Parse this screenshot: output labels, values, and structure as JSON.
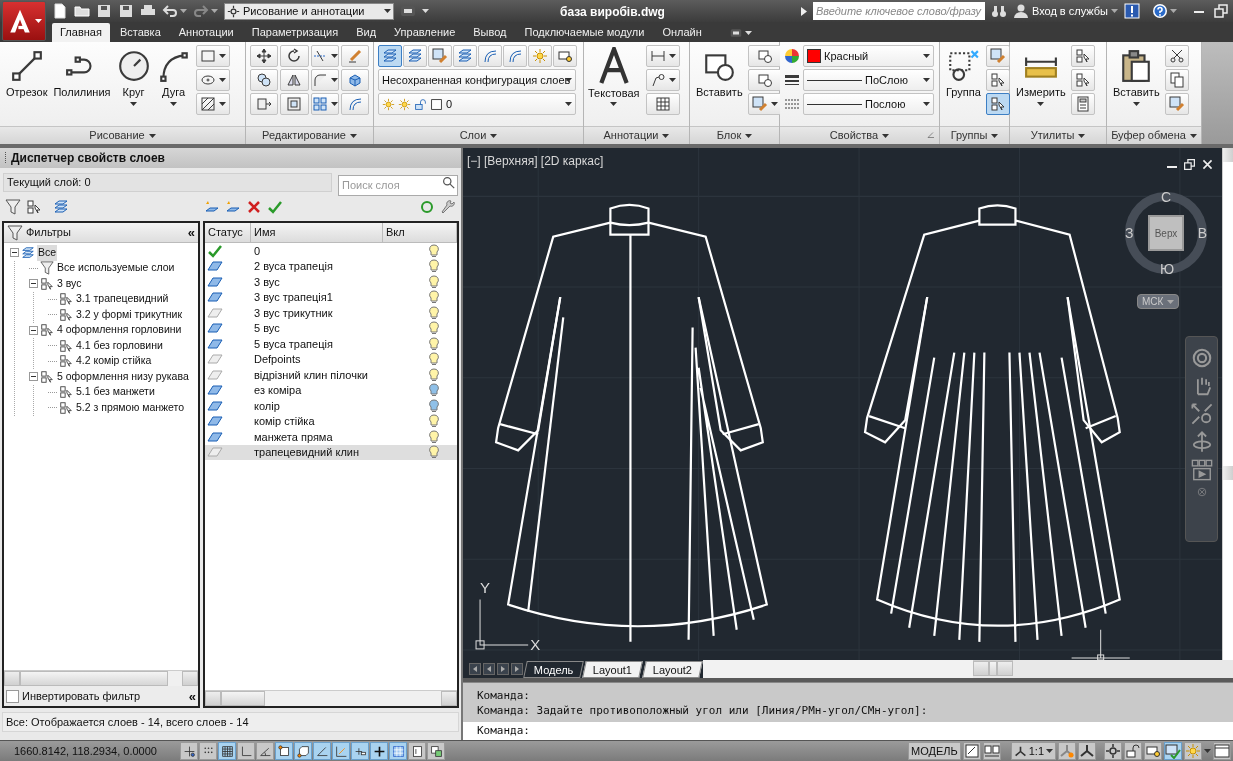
{
  "title_bar": {
    "workspace": "Рисование и аннотации",
    "title": "база виробів.dwg",
    "search_placeholder": "Введите ключевое слово/фразу",
    "sign_in": "Вход в службы"
  },
  "ribbon_tabs": [
    {
      "label": "Главная",
      "selected": true
    },
    {
      "label": "Вставка",
      "selected": false
    },
    {
      "label": "Аннотации",
      "selected": false
    },
    {
      "label": "Параметризация",
      "selected": false
    },
    {
      "label": "Вид",
      "selected": false
    },
    {
      "label": "Управление",
      "selected": false
    },
    {
      "label": "Вывод",
      "selected": false
    },
    {
      "label": "Подключаемые модули",
      "selected": false
    },
    {
      "label": "Онлайн",
      "selected": false
    }
  ],
  "ribbon": {
    "draw": {
      "label": "Рисование",
      "buttons": [
        "Отрезок",
        "Полилиния",
        "Круг",
        "Дуга"
      ]
    },
    "modify": {
      "label": "Редактирование"
    },
    "layers": {
      "label": "Слои",
      "tools": [
        {
          "on": true
        },
        {
          "on": false
        },
        {
          "on": false
        },
        {
          "on": false
        },
        {
          "on": false
        },
        {
          "on": false
        },
        {
          "on": false
        },
        {
          "on": false
        }
      ],
      "layer_state": "Несохраненная конфигурация слоев",
      "current_layer": "0"
    },
    "annotation": {
      "label": "Аннотации",
      "button": "Текстовая"
    },
    "block": {
      "label": "Блок",
      "button": "Вставить"
    },
    "properties": {
      "label": "Свойства",
      "color": {
        "label": "Красный",
        "color": "#ff0000"
      },
      "lineweight": "ПоСлою",
      "linetype": "Послою"
    },
    "groups": {
      "label": "Группы",
      "button": "Группа",
      "tools": [
        {
          "on": false
        },
        {
          "on": false
        },
        {
          "on": true
        }
      ]
    },
    "utilities": {
      "label": "Утилиты",
      "button": "Измерить"
    },
    "clipboard": {
      "label": "Буфер обмена",
      "button": "Вставить"
    }
  },
  "layer_manager": {
    "title": "Диспетчер свойств слоев",
    "current_layer": "Текущий слой: 0",
    "search_placeholder": "Поиск слоя",
    "filters_header": "Фильтры",
    "filters_collapse": "«",
    "filter_tree": [
      {
        "label": "Все",
        "kind": "all",
        "selected": true,
        "expanded": true,
        "children": [
          {
            "label": "Все используемые слои",
            "kind": "used",
            "selected": false
          },
          {
            "label": "3 вус",
            "kind": "group",
            "selected": false,
            "expanded": true,
            "children": [
              {
                "label": "3.1 трапецевидний",
                "kind": "group",
                "selected": false
              },
              {
                "label": "3.2 у формі трикутник",
                "kind": "group",
                "selected": false
              }
            ]
          },
          {
            "label": "4 оформлення горловини",
            "kind": "group",
            "selected": false,
            "expanded": true,
            "children": [
              {
                "label": "4.1 без горловини",
                "kind": "group",
                "selected": false
              },
              {
                "label": "4.2 комір стійка",
                "kind": "group",
                "selected": false
              }
            ]
          },
          {
            "label": "5 оформлення низу рукава",
            "kind": "group",
            "selected": false,
            "expanded": true,
            "children": [
              {
                "label": "5.1 без манжети",
                "kind": "group",
                "selected": false
              },
              {
                "label": "5.2 з прямою манжето",
                "kind": "group",
                "selected": false
              }
            ]
          }
        ]
      }
    ],
    "invert_filter": {
      "label": "Инвертировать фильтр",
      "checked": false
    },
    "invert_collapse": "«",
    "columns": [
      "Статус",
      "Имя",
      "Вкл"
    ],
    "layers": [
      {
        "kind": "current",
        "name": "0",
        "on": true,
        "selected": false
      },
      {
        "kind": "used",
        "name": "2 вуса трапеція",
        "on": true,
        "selected": false
      },
      {
        "kind": "used",
        "name": "3 вус",
        "on": true,
        "selected": false
      },
      {
        "kind": "used",
        "name": "3 вус трапеція1",
        "on": true,
        "selected": false
      },
      {
        "kind": "unused",
        "name": "3 вус трикутник",
        "on": true,
        "selected": false
      },
      {
        "kind": "used",
        "name": "5 вус",
        "on": true,
        "selected": false
      },
      {
        "kind": "used",
        "name": "5 вуса трапеція",
        "on": true,
        "selected": false
      },
      {
        "kind": "unused",
        "name": "Defpoints",
        "on": true,
        "selected": false
      },
      {
        "kind": "unused",
        "name": "відрізний клин пілочки",
        "on": true,
        "selected": false
      },
      {
        "kind": "used",
        "name": "ез коміра",
        "on": false,
        "selected": false
      },
      {
        "kind": "used",
        "name": "колір",
        "on": false,
        "selected": false
      },
      {
        "kind": "used",
        "name": "комір стійка",
        "on": true,
        "selected": false
      },
      {
        "kind": "used",
        "name": "манжета пряма",
        "on": true,
        "selected": false
      },
      {
        "kind": "unused",
        "name": "трапецевидний клин",
        "on": true,
        "selected": true
      }
    ],
    "summary": "Все: Отображается слоев - 14, всего слоев - 14"
  },
  "viewport": {
    "label": "[−] [Верхняя] [2D каркас]",
    "viewcube": {
      "north": "С",
      "east": "В",
      "south": "Ю",
      "west": "З",
      "face": "Верх"
    },
    "ucs_menu": "МСК",
    "axes": {
      "y": "Y",
      "x": "X"
    }
  },
  "layout_tabs": [
    {
      "label": "Модель",
      "selected": true
    },
    {
      "label": "Layout1",
      "selected": false
    },
    {
      "label": "Layout2",
      "selected": false
    }
  ],
  "command_line": {
    "history": [
      "Команда:",
      "Команда: Задайте противоположный угол или [Линия/РМн-угол/СМн-угол]:"
    ],
    "prompt": "Команда:"
  },
  "status_bar": {
    "coordinates": "1660.8142, 118.2934, 0.0000",
    "toggles": [
      {
        "on": false
      },
      {
        "on": false
      },
      {
        "on": true
      },
      {
        "on": false
      },
      {
        "on": false
      },
      {
        "on": true
      },
      {
        "on": true
      },
      {
        "on": true
      },
      {
        "on": true
      },
      {
        "on": true
      },
      {
        "on": true
      },
      {
        "on": true
      },
      {
        "on": false
      },
      {
        "on": false
      }
    ],
    "space": "МОДЕЛЬ",
    "annotation_scale": "1:1"
  }
}
